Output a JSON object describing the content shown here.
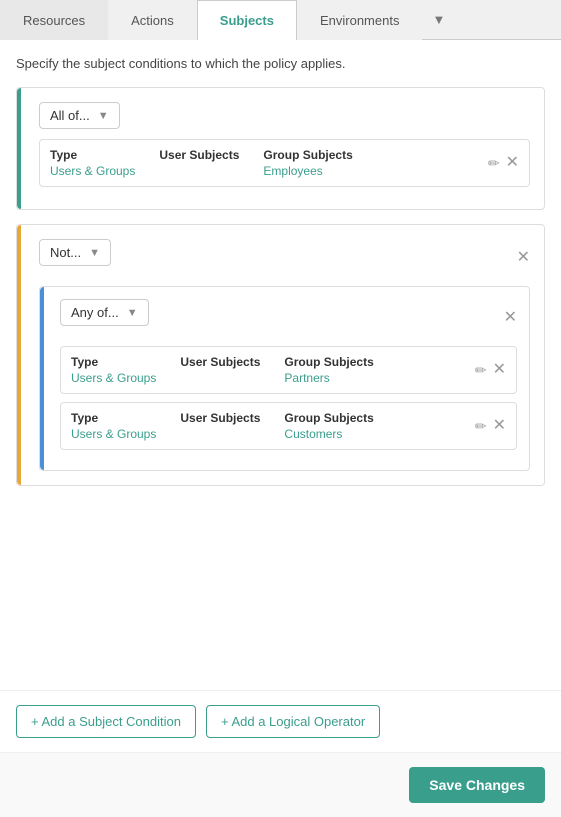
{
  "tabs": [
    {
      "id": "resources",
      "label": "Resources",
      "active": false
    },
    {
      "id": "actions",
      "label": "Actions",
      "active": false
    },
    {
      "id": "subjects",
      "label": "Subjects",
      "active": true
    },
    {
      "id": "environments",
      "label": "Environments",
      "active": false
    }
  ],
  "more_label": "▼",
  "description": "Specify the subject conditions to which the policy applies.",
  "outer_block1": {
    "operator_label": "All of...",
    "operator_arrow": "▼",
    "rows": [
      {
        "type_label": "Type",
        "type_value": "Users & Groups",
        "user_subjects_label": "User Subjects",
        "user_subjects_value": "",
        "group_subjects_label": "Group Subjects",
        "group_subjects_value": "Employees"
      }
    ]
  },
  "outer_block2": {
    "operator_label": "Not...",
    "operator_arrow": "▼",
    "inner_block": {
      "operator_label": "Any of...",
      "operator_arrow": "▼",
      "rows": [
        {
          "type_label": "Type",
          "type_value": "Users & Groups",
          "user_subjects_label": "User Subjects",
          "user_subjects_value": "",
          "group_subjects_label": "Group Subjects",
          "group_subjects_value": "Partners"
        },
        {
          "type_label": "Type",
          "type_value": "Users & Groups",
          "user_subjects_label": "User Subjects",
          "user_subjects_value": "",
          "group_subjects_label": "Group Subjects",
          "group_subjects_value": "Customers"
        }
      ]
    }
  },
  "buttons": {
    "add_condition": "+ Add a Subject Condition",
    "add_operator": "+ Add a Logical Operator",
    "save": "Save Changes"
  }
}
